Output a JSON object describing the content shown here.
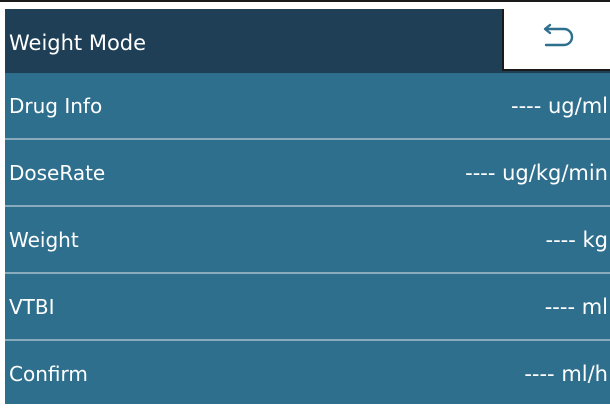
{
  "header": {
    "title": "Weight Mode",
    "back_icon": "return-arrow-icon"
  },
  "rows": [
    {
      "label": "Drug Info",
      "value": "---- ug/ml"
    },
    {
      "label": "DoseRate",
      "value": "---- ug/kg/min"
    },
    {
      "label": "Weight",
      "value": "---- kg"
    },
    {
      "label": "VTBI",
      "value": "---- ml"
    },
    {
      "label": "Confirm",
      "value": "---- ml/h"
    }
  ],
  "colors": {
    "header_bg": "#1e3f55",
    "row_bg": "#2f6f8e",
    "divider": "#8aaabd",
    "text": "#ffffff"
  }
}
